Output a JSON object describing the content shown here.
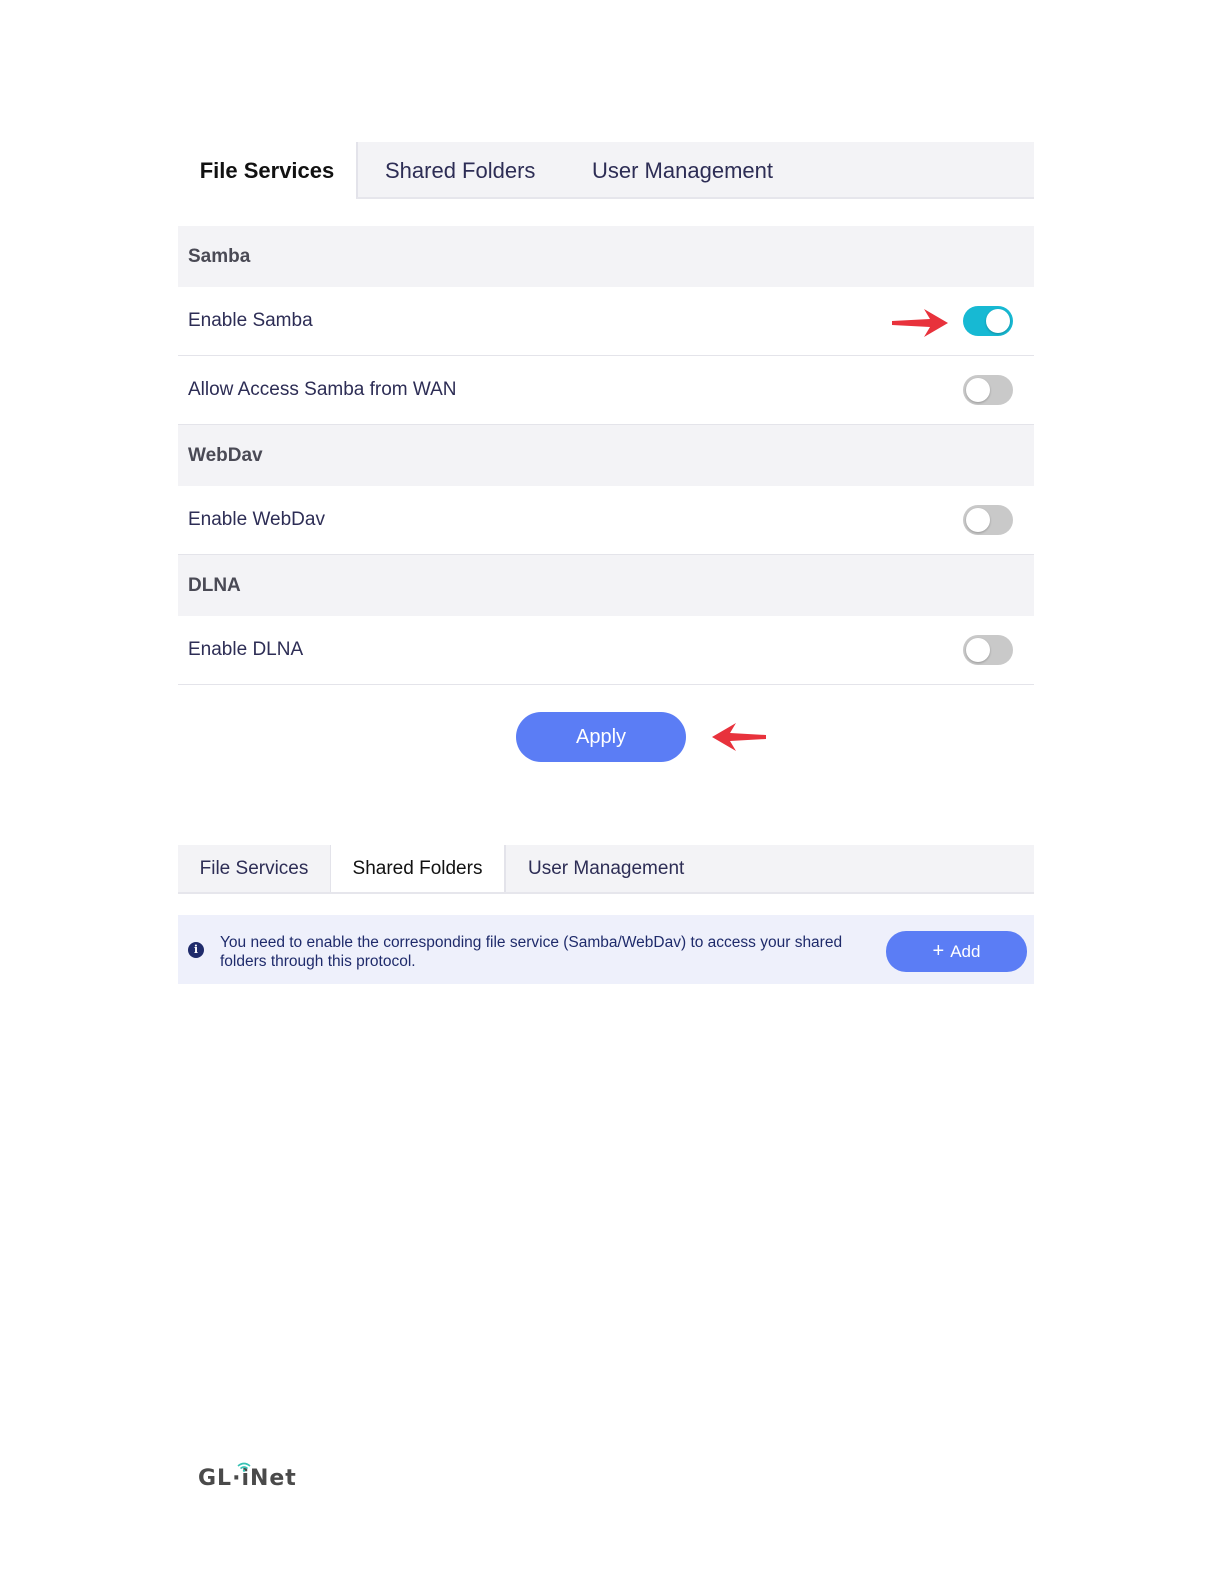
{
  "top_panel": {
    "tabs": [
      {
        "label": "File Services",
        "active": true
      },
      {
        "label": "Shared Folders",
        "active": false
      },
      {
        "label": "User Management",
        "active": false
      }
    ],
    "sections": {
      "samba": {
        "title": "Samba",
        "enable_label": "Enable Samba",
        "enable_on": true,
        "wan_label": "Allow Access Samba from WAN",
        "wan_on": false
      },
      "webdav": {
        "title": "WebDav",
        "enable_label": "Enable WebDav",
        "enable_on": false
      },
      "dlna": {
        "title": "DLNA",
        "enable_label": "Enable DLNA",
        "enable_on": false
      }
    },
    "apply_label": "Apply"
  },
  "bottom_panel": {
    "tabs": [
      {
        "label": "File Services",
        "active": false
      },
      {
        "label": "Shared Folders",
        "active": true
      },
      {
        "label": "User Management",
        "active": false
      }
    ],
    "info_icon_glyph": "i",
    "info_text": "You need to enable the corresponding file service (Samba/WebDav) to access your shared folders through this protocol.",
    "add_icon_glyph": "+",
    "add_label": "Add"
  },
  "logo": {
    "text_left": "GL·",
    "text_right": "iNet"
  },
  "colors": {
    "accent": "#5b7df5",
    "toggle_on": "#17b9d3",
    "toggle_off": "#c9c9c9",
    "annotation_arrow": "#e8323c"
  }
}
